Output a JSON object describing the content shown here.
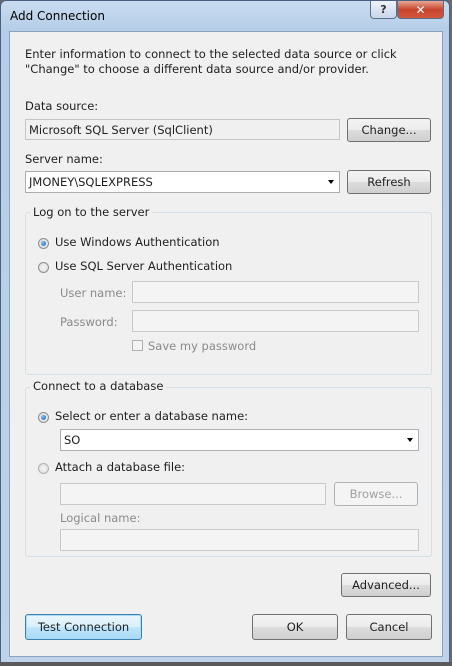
{
  "window": {
    "title": "Add Connection",
    "help_label": "?",
    "close_label": "✕"
  },
  "intro": "Enter information to connect to the selected data source or click \"Change\" to choose a different data source and/or provider.",
  "data_source": {
    "label": "Data source:",
    "value": "Microsoft SQL Server (SqlClient)",
    "change_label": "Change..."
  },
  "server": {
    "label": "Server name:",
    "value": "JMONEY\\SQLEXPRESS",
    "refresh_label": "Refresh"
  },
  "logon": {
    "group_title": "Log on to the server",
    "windows_auth_label": "Use Windows Authentication",
    "windows_auth_selected": true,
    "sql_auth_label": "Use SQL Server Authentication",
    "user_name_label": "User name:",
    "user_name_value": "",
    "password_label": "Password:",
    "password_value": "",
    "save_password_label": "Save my password",
    "save_password_checked": false
  },
  "database": {
    "group_title": "Connect to a database",
    "select_label": "Select or enter a database name:",
    "select_selected": true,
    "database_name": "SO",
    "attach_label": "Attach a database file:",
    "attach_value": "",
    "browse_label": "Browse...",
    "logical_name_label": "Logical name:",
    "logical_name_value": ""
  },
  "footer": {
    "advanced_label": "Advanced...",
    "test_connection_label": "Test Connection",
    "ok_label": "OK",
    "cancel_label": "Cancel"
  }
}
